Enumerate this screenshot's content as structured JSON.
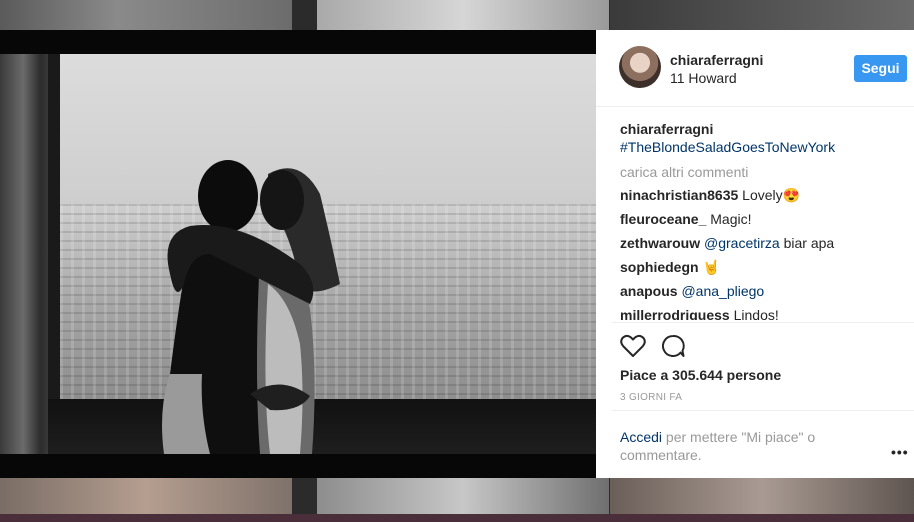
{
  "post": {
    "username": "chiaraferragni",
    "location": "11 Howard",
    "follow_label": "Segui",
    "caption": {
      "user": "chiaraferragni",
      "hashtag": "#TheBlondeSaladGoesToNewYork"
    },
    "load_more_label": "carica altri commenti",
    "comments": [
      {
        "user": "ninachristian8635",
        "text": "Lovely😍"
      },
      {
        "user": "fleuroceane_",
        "text": "Magic!"
      },
      {
        "user": "zethwarouw",
        "mention": "@gracetirza",
        "text": "biar apa"
      },
      {
        "user": "sophiedegn",
        "text": "🤘"
      },
      {
        "user": "anapous",
        "mention": "@ana_pliego",
        "text": ""
      },
      {
        "user": "millerrodriguess",
        "text": "Lindos!"
      }
    ],
    "likes_label": "Piace a 305.644 persone",
    "time_ago": "3 GIORNI FA",
    "footer": {
      "login_label": "Accedi",
      "text": "per mettere \"Mi piace\" o commentare."
    },
    "icons": {
      "like": "heart-icon",
      "comment": "comment-bubble-icon",
      "more": "more-options-icon"
    },
    "colors": {
      "follow_button": "#3897f0",
      "link": "#003569",
      "muted": "#999999"
    }
  }
}
